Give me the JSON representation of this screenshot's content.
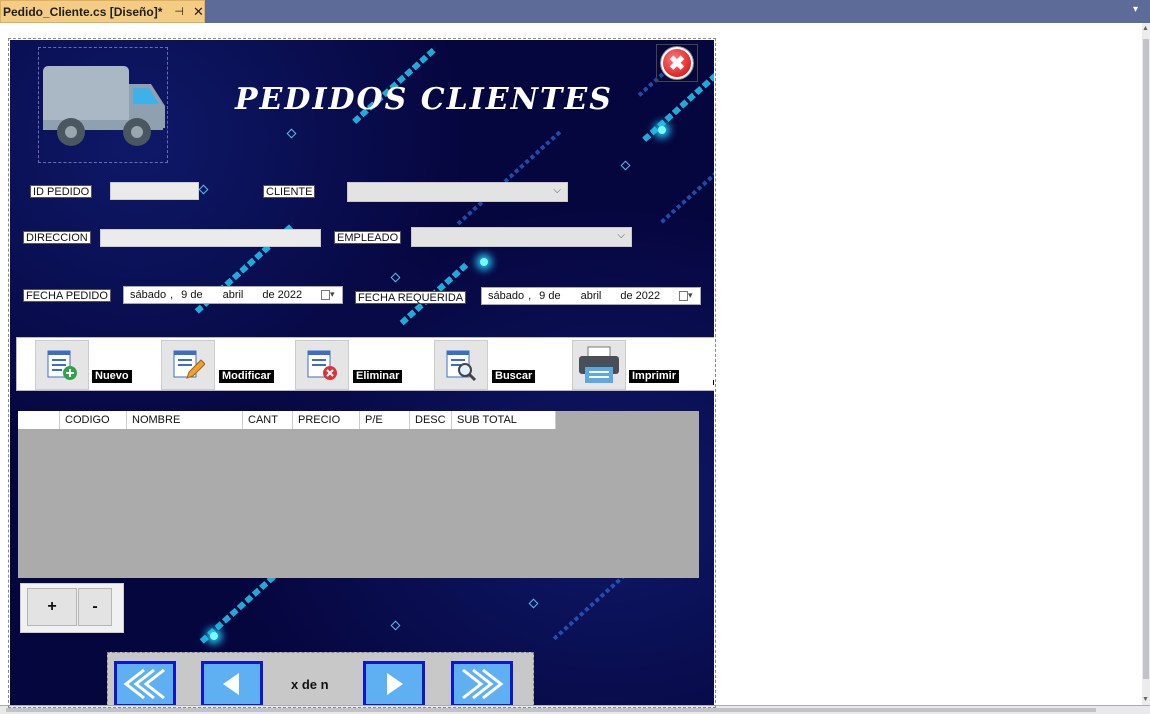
{
  "ide": {
    "tab_title": "Pedido_Cliente.cs [Diseño]*",
    "pin_glyph": "⊣",
    "close_glyph": "✕",
    "dropdown_glyph": "▾"
  },
  "form": {
    "title": "PEDIDOS CLIENTES",
    "close_glyph": "✖",
    "fields": {
      "id_pedido_label": "ID PEDIDO",
      "cliente_label": "CLIENTE",
      "direccion_label": "DIRECCION",
      "empleado_label": "EMPLEADO",
      "fecha_pedido_label": "FECHA PEDIDO",
      "fecha_requerida_label": "FECHA REQUERIDA"
    },
    "dates": {
      "pedido": {
        "weekday": "sábado",
        "day": "9 de",
        "month": "abril",
        "year": "de 2022"
      },
      "requerida": {
        "weekday": "sábado",
        "day": "9 de",
        "month": "abril",
        "year": "de 2022"
      }
    },
    "toolbar": {
      "nuevo": "Nuevo",
      "modificar": "Modificar",
      "eliminar": "Eliminar",
      "buscar": "Buscar",
      "imprimir": "Imprimir"
    },
    "grid_columns": [
      "",
      "CODIGO",
      "NOMBRE",
      "CANT",
      "PRECIO",
      "P/E",
      "DESC",
      "SUB TOTAL"
    ],
    "plus_label": "+",
    "minus_label": "-",
    "nav": {
      "record_text": "x de n"
    }
  },
  "colors": {
    "accent_cyan": "#21c8f3",
    "form_bg": "#06063f",
    "nav_border": "#0d18c8",
    "nav_fill": "#5fb0f3"
  },
  "icons": [
    "truck-icon",
    "close-icon",
    "add-document-icon",
    "edit-document-icon",
    "delete-document-icon",
    "search-document-icon",
    "printer-icon",
    "first-icon",
    "previous-icon",
    "next-icon",
    "last-icon"
  ]
}
